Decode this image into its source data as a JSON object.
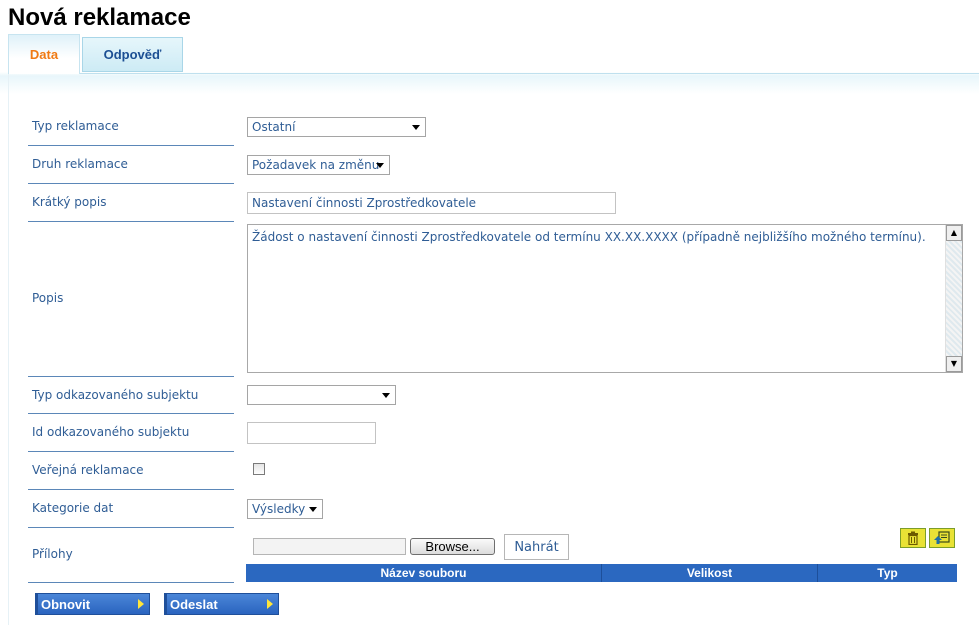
{
  "page": {
    "title": "Nová reklamace"
  },
  "tabs": [
    {
      "label": "Data",
      "active": true
    },
    {
      "label": "Odpověď",
      "active": false
    }
  ],
  "form": {
    "typ_reklamace": {
      "label": "Typ reklamace",
      "value": "Ostatní"
    },
    "druh_reklamace": {
      "label": "Druh reklamace",
      "value": "Požadavek na změnu"
    },
    "kratky_popis": {
      "label": "Krátký popis",
      "value": "Nastavení činnosti Zprostředkovatele"
    },
    "popis": {
      "label": "Popis",
      "value": "Žádost o nastavení činnosti Zprostředkovatele od termínu XX.XX.XXXX (případně nejbližšího možného termínu)."
    },
    "typ_subjektu": {
      "label": "Typ odkazovaného subjektu",
      "value": ""
    },
    "id_subjektu": {
      "label": "Id odkazovaného subjektu",
      "value": ""
    },
    "verejna": {
      "label": "Veřejná reklamace",
      "checked": false
    },
    "kategorie": {
      "label": "Kategorie dat",
      "value": "Výsledky"
    },
    "prilohy": {
      "label": "Přílohy",
      "browse_label": "Browse...",
      "upload_label": "Nahrát",
      "columns": [
        "Název souboru",
        "Velikost",
        "Typ"
      ]
    }
  },
  "actions": {
    "refresh_label": "Obnovit",
    "send_label": "Odeslat"
  },
  "colors": {
    "accent": "#f07a13",
    "link": "#2f5d95",
    "table_header": "#2b68c0"
  }
}
